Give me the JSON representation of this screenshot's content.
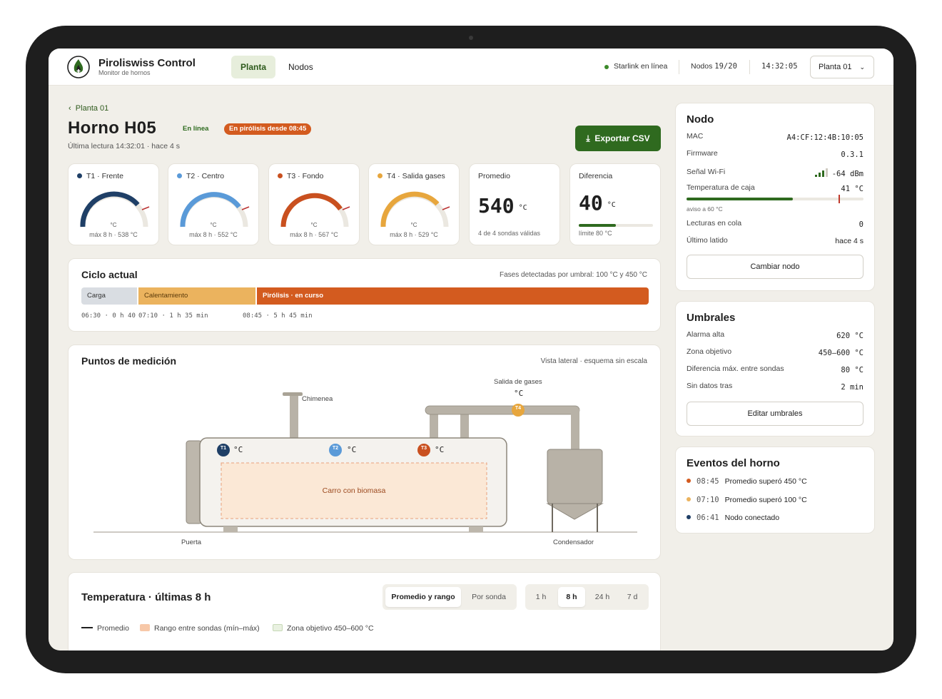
{
  "app": {
    "title": "Piroliswiss Control",
    "subtitle": "Monitor de hornos"
  },
  "nav": {
    "tabs": [
      {
        "label": "Planta",
        "active": true
      },
      {
        "label": "Nodos",
        "active": false
      }
    ]
  },
  "topbar": {
    "starlink": "Starlink en línea",
    "nodes_label": "Nodos",
    "nodes_value": "19/20",
    "clock": "14:32:05",
    "plant_select": "Planta 01"
  },
  "header": {
    "breadcrumb": "Planta 01",
    "title": "Horno H05",
    "status_online": "En línea",
    "status_phase": "En pirólisis desde 08:45",
    "last_reading": "Última lectura 14:32:01 · hace 4 s",
    "export_label": "Exportar CSV"
  },
  "sensors": [
    {
      "label": "T1 · Frente",
      "color": "#1f3f66",
      "unit": "°C",
      "max": "máx 8 h · 538 °C"
    },
    {
      "label": "T2 · Centro",
      "color": "#5a9ad8",
      "unit": "°C",
      "max": "máx 8 h · 552 °C"
    },
    {
      "label": "T3 · Fondo",
      "color": "#c9501f",
      "unit": "°C",
      "max": "máx 8 h · 567 °C"
    },
    {
      "label": "T4 · Salida gases",
      "color": "#e7a63d",
      "unit": "°C",
      "max": "máx 8 h · 529 °C"
    }
  ],
  "average": {
    "label": "Promedio",
    "value": "540",
    "unit": "°C",
    "note": "4 de 4 sondas válidas"
  },
  "difference": {
    "label": "Diferencia",
    "value": "40",
    "unit": "°C",
    "note": "límite 80 °C",
    "fraction": 0.5
  },
  "cycle": {
    "title": "Ciclo actual",
    "note": "Fases detectadas por umbral: 100 °C y 450 °C",
    "phases": [
      {
        "label": "Carga",
        "color": "#d9dde2",
        "text_color": "#333333"
      },
      {
        "label": "Calentamiento",
        "color": "#ebb35e",
        "text_color": "#5a3a0a"
      },
      {
        "label": "Pirólisis · en curso",
        "color": "#d35b1f",
        "text_color": "#ffffff"
      }
    ],
    "times": [
      "06:30 · 0 h 40",
      "07:10 · 1 h 35 min",
      "08:45 · 5 h 45 min"
    ]
  },
  "diagram": {
    "title": "Puntos de medición",
    "note": "Vista lateral · esquema sin escala",
    "chimney": "Chimenea",
    "gas_outlet": "Salida de gases",
    "gas_unit": "°C",
    "probe_unit": "°C",
    "probes": [
      "T1",
      "T2",
      "T3",
      "T4"
    ],
    "cart": "Carro con biomasa",
    "door": "Puerta",
    "condenser": "Condensador"
  },
  "trend": {
    "title": "Temperatura · últimas 8 h",
    "modes": [
      {
        "label": "Promedio y rango",
        "active": true
      },
      {
        "label": "Por sonda",
        "active": false
      }
    ],
    "ranges": [
      {
        "label": "1 h",
        "active": false
      },
      {
        "label": "8 h",
        "active": true
      },
      {
        "label": "24 h",
        "active": false
      },
      {
        "label": "7 d",
        "active": false
      }
    ],
    "legend": [
      "Promedio",
      "Rango entre sondas (mín–máx)",
      "Zona objetivo 450–600 °C"
    ]
  },
  "node": {
    "title": "Nodo",
    "mac_label": "MAC",
    "mac": "A4:CF:12:4B:10:05",
    "fw_label": "Firmware",
    "fw": "0.3.1",
    "wifi_label": "Señal Wi-Fi",
    "wifi": "-64 dBm",
    "box_label": "Temperatura de caja",
    "box": "41 °C",
    "box_fraction": 0.6,
    "box_warn": "aviso a 60 °C",
    "queue_label": "Lecturas en cola",
    "queue": "0",
    "beat_label": "Último latido",
    "beat": "hace 4 s",
    "change_label": "Cambiar nodo"
  },
  "thresholds": {
    "title": "Umbrales",
    "rows": [
      {
        "label": "Alarma alta",
        "value": "620 °C"
      },
      {
        "label": "Zona objetivo",
        "value": "450–600 °C"
      },
      {
        "label": "Diferencia máx. entre sondas",
        "value": "80 °C"
      },
      {
        "label": "Sin datos tras",
        "value": "2 min"
      }
    ],
    "edit_label": "Editar umbrales"
  },
  "events": {
    "title": "Eventos del horno",
    "items": [
      {
        "time": "08:45",
        "text": "Promedio superó 450 °C",
        "color": "#d35b1f"
      },
      {
        "time": "07:10",
        "text": "Promedio superó 100 °C",
        "color": "#ebb35e"
      },
      {
        "time": "06:41",
        "text": "Nodo conectado",
        "color": "#1f3f66"
      }
    ]
  }
}
